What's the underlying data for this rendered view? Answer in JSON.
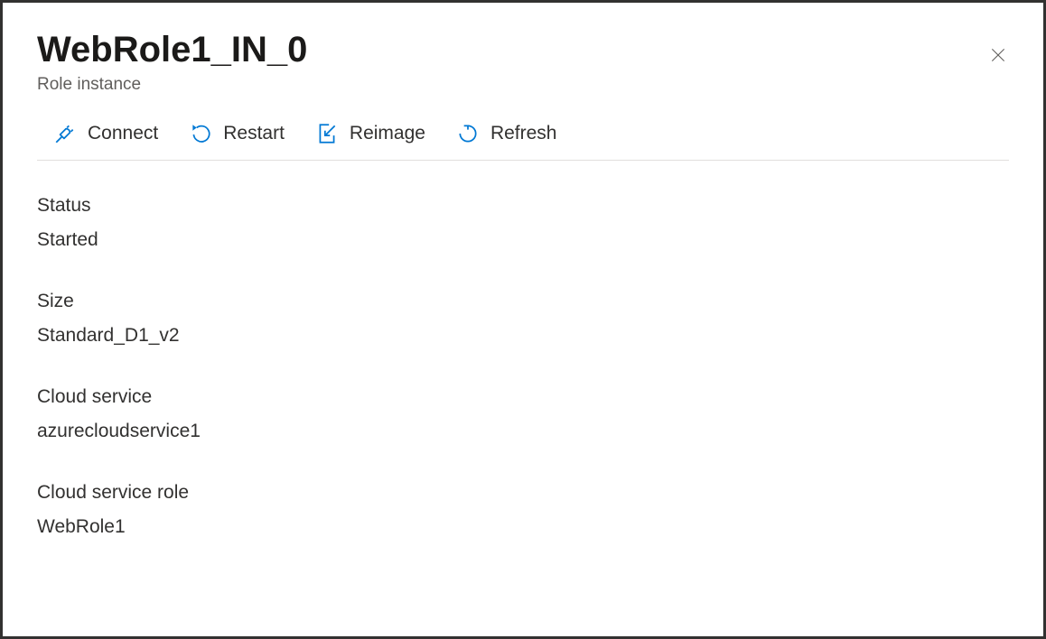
{
  "header": {
    "title": "WebRole1_IN_0",
    "subtitle": "Role instance"
  },
  "toolbar": {
    "connect_label": "Connect",
    "restart_label": "Restart",
    "reimage_label": "Reimage",
    "refresh_label": "Refresh"
  },
  "details": {
    "status_label": "Status",
    "status_value": "Started",
    "size_label": "Size",
    "size_value": "Standard_D1_v2",
    "cloud_service_label": "Cloud service",
    "cloud_service_value": "azurecloudservice1",
    "cloud_service_role_label": "Cloud service role",
    "cloud_service_role_value": "WebRole1"
  }
}
